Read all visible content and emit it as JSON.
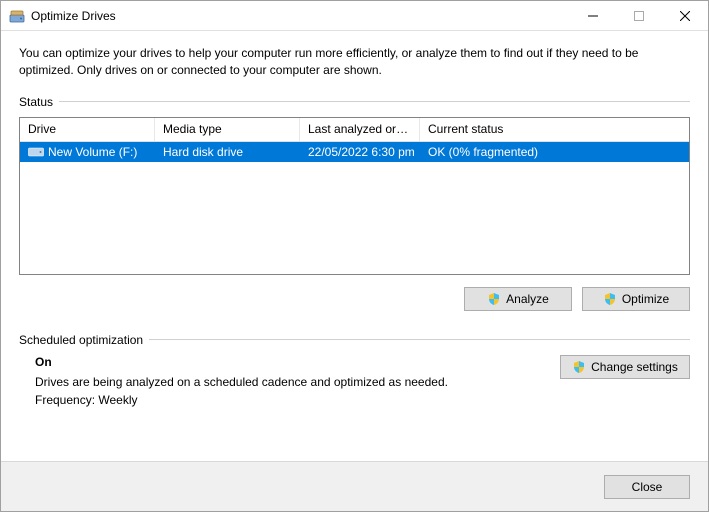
{
  "window": {
    "title": "Optimize Drives",
    "intro": "You can optimize your drives to help your computer run more efficiently, or analyze them to find out if they need to be optimized. Only drives on or connected to your computer are shown."
  },
  "status": {
    "label": "Status",
    "columns": {
      "drive": "Drive",
      "media": "Media type",
      "last": "Last analyzed or o...",
      "status": "Current status"
    },
    "rows": [
      {
        "drive": "New Volume (F:)",
        "media": "Hard disk drive",
        "last": "22/05/2022 6:30 pm",
        "status": "OK (0% fragmented)",
        "selected": true
      }
    ]
  },
  "buttons": {
    "analyze": "Analyze",
    "optimize": "Optimize",
    "change": "Change settings",
    "close": "Close"
  },
  "schedule": {
    "label": "Scheduled optimization",
    "state": "On",
    "desc": "Drives are being analyzed on a scheduled cadence and optimized as needed.",
    "frequency": "Frequency: Weekly"
  }
}
